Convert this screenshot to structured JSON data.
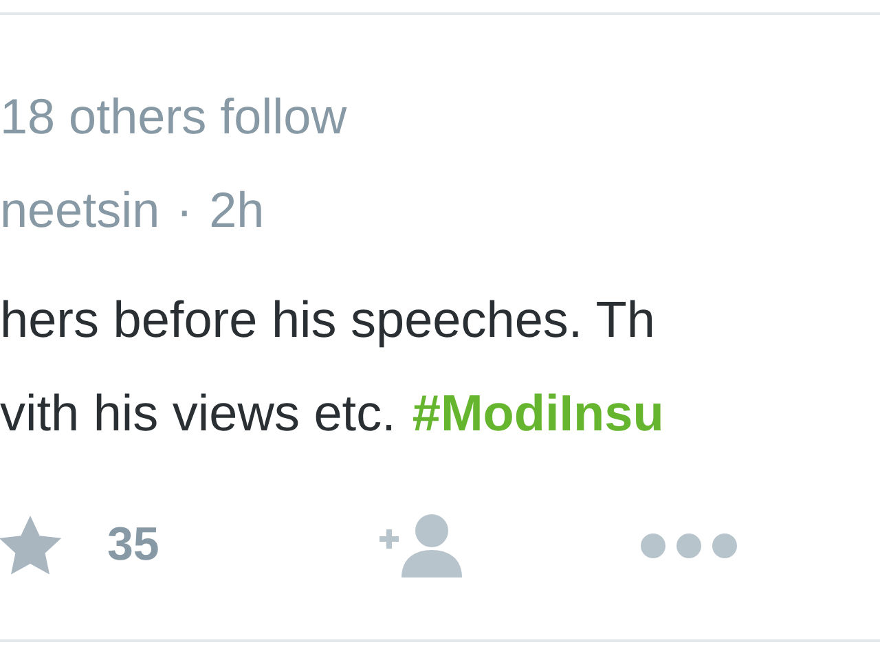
{
  "social_context": "18 others follow",
  "author": {
    "handle": "neetsin",
    "separator": "·",
    "time": "2h"
  },
  "tweet": {
    "lines": [
      "hers before his speeches. Th",
      "vith his views etc."
    ],
    "hashtag": "#ModiInsu"
  },
  "actions": [
    {
      "kind": "favorite",
      "count": "35"
    },
    {
      "kind": "follow"
    },
    {
      "kind": "more"
    }
  ]
}
